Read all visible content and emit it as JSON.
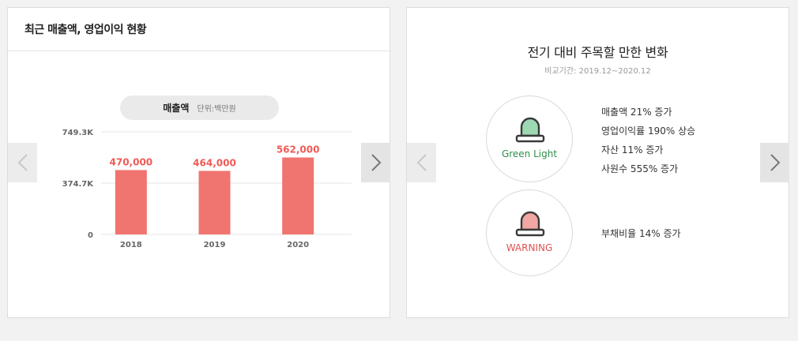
{
  "left_panel": {
    "title": "최근 매출액, 영업이익 현황",
    "metric_label": "매출액",
    "unit_label": "단위:백만원"
  },
  "chart_data": {
    "type": "bar",
    "categories": [
      "2018",
      "2019",
      "2020"
    ],
    "values": [
      470000,
      464000,
      562000
    ],
    "value_labels": [
      "470,000",
      "464,000",
      "562,000"
    ],
    "y_ticks": [
      0,
      374700,
      749300
    ],
    "y_tick_labels": [
      "0",
      "374.7K",
      "749.3K"
    ],
    "ylim": [
      0,
      749300
    ],
    "bar_color": "#f07470",
    "label_color": "#f05a55",
    "grid": true
  },
  "right_panel": {
    "title": "전기 대비 주목할 만한 변화",
    "period": "비교기간: 2019.12~2020.12",
    "green": {
      "label": "Green Light",
      "icon": "green-siren-icon",
      "color": "#2e8f4c",
      "items": [
        "매출액 21% 증가",
        "영업이익률 190% 상승",
        "자산 11% 증가",
        "사원수 555% 증가"
      ]
    },
    "warning": {
      "label": "WARNING",
      "icon": "red-siren-icon",
      "color": "#e35050",
      "items": [
        "부채비율 14% 증가"
      ]
    }
  },
  "nav": {
    "prev_icon": "chevron-left-icon",
    "next_icon": "chevron-right-icon"
  }
}
